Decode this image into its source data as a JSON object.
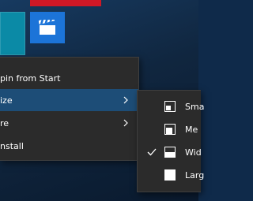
{
  "context_menu": {
    "items": [
      {
        "label": "pin from Start",
        "has_submenu": false,
        "highlighted": false
      },
      {
        "label": "ize",
        "has_submenu": true,
        "highlighted": true
      },
      {
        "label": "re",
        "has_submenu": true,
        "highlighted": false
      },
      {
        "label": "nstall",
        "has_submenu": false,
        "highlighted": false
      }
    ]
  },
  "resize_submenu": {
    "items": [
      {
        "label": "Sma",
        "icon": "small-tile-icon",
        "checked": false
      },
      {
        "label": "Me",
        "icon": "medium-tile-icon",
        "checked": false
      },
      {
        "label": "Wid",
        "icon": "wide-tile-icon",
        "checked": true
      },
      {
        "label": "Larg",
        "icon": "large-tile-icon",
        "checked": false
      }
    ]
  },
  "colors": {
    "menu_bg": "#2b2b2b",
    "highlight": "#1d4d77",
    "tile_teal": "#0b8aa6",
    "tile_blue": "#1c74d8",
    "tile_red": "#d01826"
  }
}
